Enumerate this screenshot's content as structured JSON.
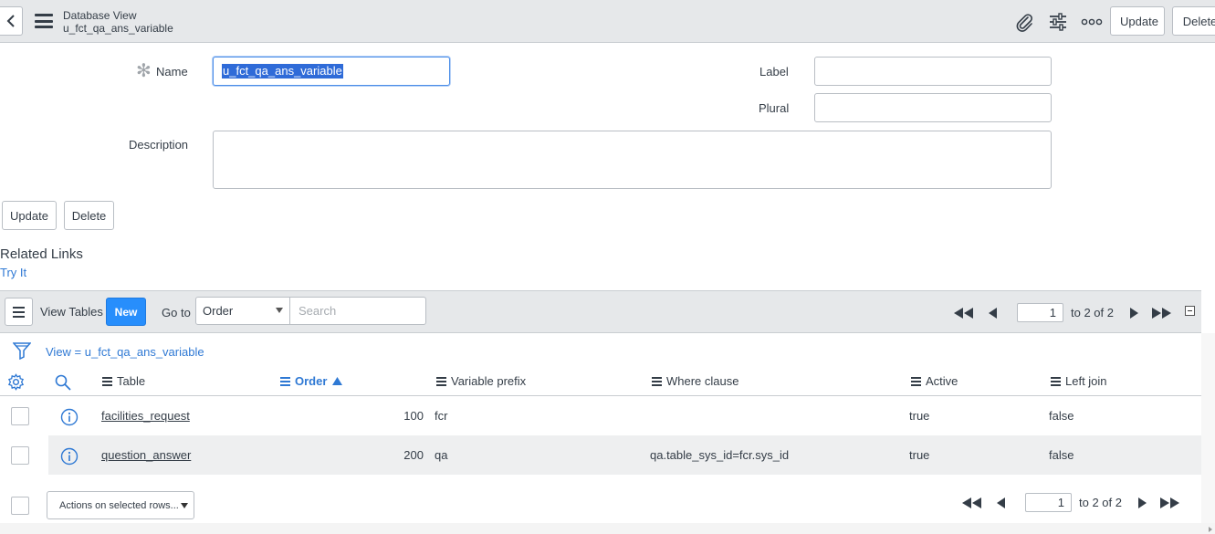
{
  "header": {
    "title": "Database View",
    "subtitle": "u_fct_qa_ans_variable",
    "update_label": "Update",
    "delete_label": "Delete"
  },
  "form": {
    "name_label": "Name",
    "name_value": "u_fct_qa_ans_variable",
    "label_label": "Label",
    "plural_label": "Plural",
    "description_label": "Description",
    "update_label": "Update",
    "delete_label": "Delete"
  },
  "related": {
    "title": "Related Links",
    "try_it": "Try It"
  },
  "list": {
    "view_tables_label": "View Tables",
    "new_label": "New",
    "goto_label": "Go to",
    "goto_selected": "Order",
    "search_placeholder": "Search",
    "page_value": "1",
    "page_text": "to 2 of 2",
    "filter_text": "View = u_fct_qa_ans_variable",
    "columns": [
      "Table",
      "Order",
      "Variable prefix",
      "Where clause",
      "Active",
      "Left join"
    ],
    "sorted_column": "Order",
    "rows": [
      {
        "table": "facilities_request",
        "order": "100",
        "prefix": "fcr",
        "where": "",
        "active": "true",
        "left_join": "false"
      },
      {
        "table": "question_answer",
        "order": "200",
        "prefix": "qa",
        "where": "qa.table_sys_id=fcr.sys_id",
        "active": "true",
        "left_join": "false"
      }
    ],
    "actions_label": "Actions on selected rows..."
  },
  "colors": {
    "accent": "#278efc",
    "link": "#2f79d4",
    "header_bg": "#e6e8ea"
  },
  "icons": [
    "back-icon",
    "hamburger-icon",
    "paperclip-icon",
    "settings-sliders-icon",
    "more-icon",
    "gear-icon",
    "search-icon",
    "filter-icon",
    "info-icon",
    "first-page-icon",
    "prev-page-icon",
    "next-page-icon",
    "last-page-icon",
    "collapse-icon"
  ]
}
